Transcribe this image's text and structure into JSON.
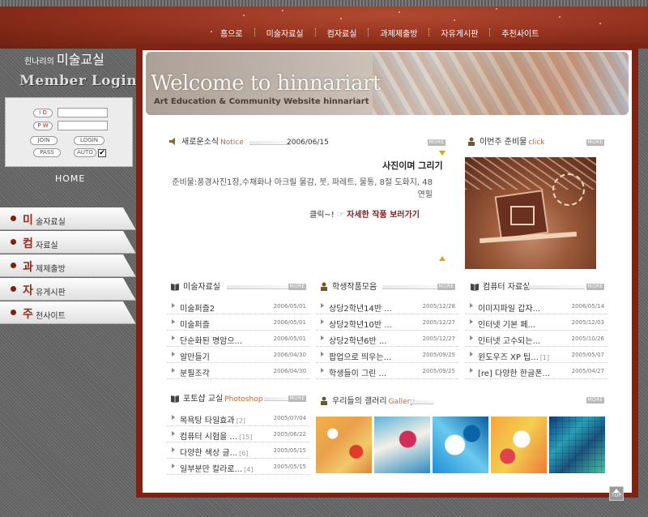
{
  "nav": [
    "홈으로",
    "미술자료실",
    "컴자료실",
    "과제제출방",
    "자유게시판",
    "추천사이트"
  ],
  "brand": {
    "prefix": "힌나리의",
    "name": "미술교실"
  },
  "login": {
    "title": "Member Login",
    "id_label": "I D",
    "pw_label": "P W",
    "join": "JOIN",
    "login": "LOGIN",
    "pass": "PASS",
    "auto": "AUTO",
    "auto_checked": "✔"
  },
  "home": "HOME",
  "side_menu": [
    {
      "first": "미",
      "rest": "술자료실"
    },
    {
      "first": "컴",
      "rest": "자료실"
    },
    {
      "first": "과",
      "rest": "제제출방"
    },
    {
      "first": "자",
      "rest": "유게시판"
    },
    {
      "first": "주",
      "rest": "천사이트"
    }
  ],
  "banner": {
    "title": "Welcome to hinnariart",
    "subtitle": "Art Education & Community Website hinnariart"
  },
  "more_label": "MORE",
  "notice": {
    "title": "새로운소식",
    "title_en": "Notice",
    "date": "2006/06/15",
    "heading": "사진이며 그리기",
    "body": "준비물:풍경사진1장,수채화나 아크릴 물감, 붓, 파레트, 물통, 8절 도화지, 48연필",
    "link_prefix": "클릭~!",
    "link": "자세한 작품 보러가기"
  },
  "weekly": {
    "title": "이번주 준비물",
    "title_en": "click"
  },
  "art_library": {
    "title": "미술자료실",
    "items": [
      {
        "title": "미술퍼즐2",
        "count": "",
        "date": "2006/05/01"
      },
      {
        "title": "미술퍼즐",
        "count": "",
        "date": "2006/05/01"
      },
      {
        "title": "단순화된 명암으...",
        "count": "",
        "date": "2006/05/01"
      },
      {
        "title": "알만들기",
        "count": "",
        "date": "2006/04/30"
      },
      {
        "title": "분필조각",
        "count": "",
        "date": "2006/04/30"
      }
    ]
  },
  "student_works": {
    "title": "학생작품모음",
    "items": [
      {
        "title": "상당2학년14반 ...",
        "count": "",
        "date": "2005/12/28"
      },
      {
        "title": "상당2학년10반 ...",
        "count": "",
        "date": "2005/12/27"
      },
      {
        "title": "상당2학년6반 ...",
        "count": "",
        "date": "2005/12/27"
      },
      {
        "title": "팝업으로 띄우는...",
        "count": "",
        "date": "2005/09/25"
      },
      {
        "title": "학생들이 그린 ...",
        "count": "",
        "date": "2005/09/25"
      }
    ]
  },
  "computer_library": {
    "title": "컴퓨터 자료실",
    "items": [
      {
        "title": "이미지파일 갑자...",
        "count": "",
        "date": "2006/05/14"
      },
      {
        "title": "인터넷 기본 페...",
        "count": "",
        "date": "2005/12/03"
      },
      {
        "title": "인터넷 고수되는...",
        "count": "",
        "date": "2005/10/26"
      },
      {
        "title": "윈도우즈 XP 팁...",
        "count": "[1]",
        "date": "2005/05/07"
      },
      {
        "title": "[re] 다양한 한글폰...",
        "count": "",
        "date": "2005/04/27"
      }
    ]
  },
  "photoshop": {
    "title": "포토샵 교실",
    "title_en": "Photoshop",
    "items": [
      {
        "title": "목욕탕 타일효과",
        "count": "[2]",
        "date": "2005/07/04"
      },
      {
        "title": "컴퓨터 시험을 ...",
        "count": "[15]",
        "date": "2005/06/22"
      },
      {
        "title": "다양한 색상 글...",
        "count": "[6]",
        "date": "2005/05/15"
      },
      {
        "title": "일부분만 칼라로...",
        "count": "[4]",
        "date": "2005/05/15"
      }
    ]
  },
  "gallery": {
    "title": "우리들의 갤러리",
    "title_en": "Gallery"
  },
  "top_label": "TOP",
  "colors": {
    "brand_red": "#8f2f1c",
    "frame": "#7d2314",
    "accent_orange": "#c0672c",
    "link_red": "#7a1e1e"
  }
}
